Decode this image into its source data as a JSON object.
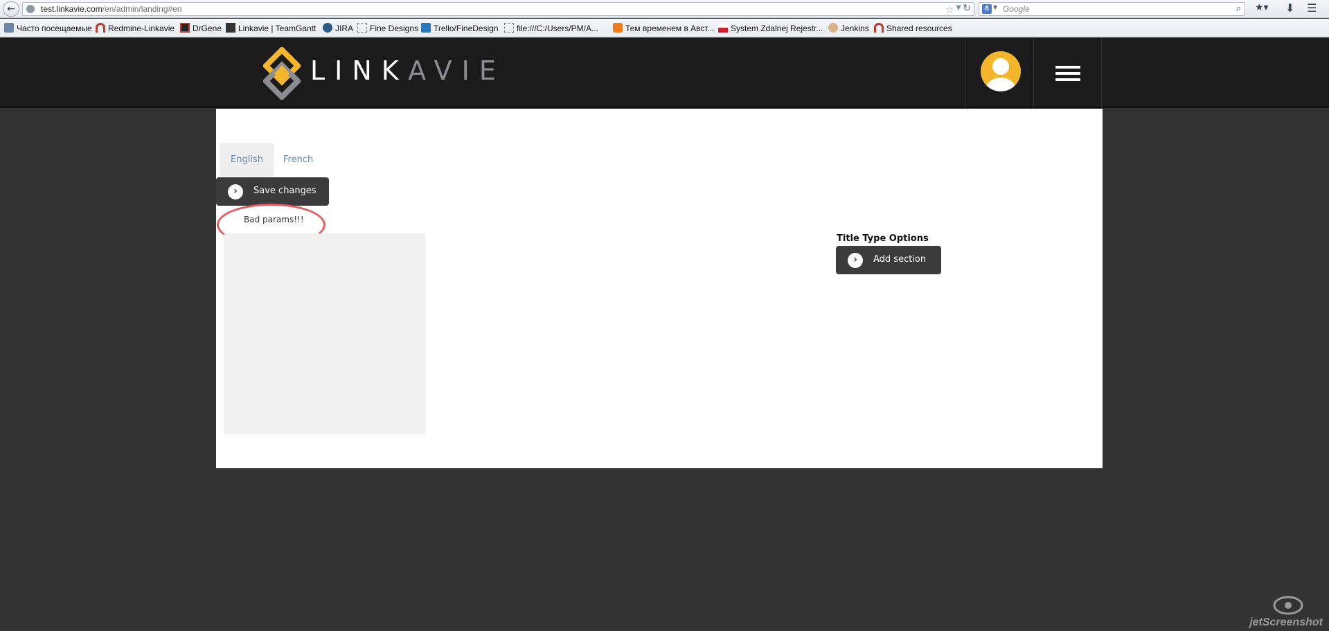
{
  "browser": {
    "url_host": "test.linkavie.com",
    "url_path": "/en/admin/landing#en",
    "search_placeholder": "Google",
    "search_engine_badge": "8"
  },
  "bookmarks": [
    {
      "label": "Часто посещаемые",
      "icon": "folder-icon"
    },
    {
      "label": "Redmine-Linkavie",
      "icon": "redmine-icon"
    },
    {
      "label": "DrGene",
      "icon": "drgene-icon"
    },
    {
      "label": "Linkavie | TeamGantt",
      "icon": "teamgantt-icon"
    },
    {
      "label": "JIRA",
      "icon": "jira-icon"
    },
    {
      "label": "Fine Designs",
      "icon": "page-icon"
    },
    {
      "label": "Trello/FineDesign",
      "icon": "trello-icon"
    },
    {
      "label": "file:///C:/Users/PM/A...",
      "icon": "page-icon"
    },
    {
      "label": "Тем временем в Авст...",
      "icon": "blogger-icon"
    },
    {
      "label": "System Zdalnej Rejestr...",
      "icon": "flag-icon"
    },
    {
      "label": "Jenkins",
      "icon": "jenkins-icon"
    },
    {
      "label": "Shared resources",
      "icon": "redmine-icon"
    }
  ],
  "site": {
    "logo_text_a": "LINK",
    "logo_text_b": "A",
    "logo_text_c": "VIE"
  },
  "tabs": [
    {
      "label": "English",
      "active": true
    },
    {
      "label": "French",
      "active": false
    }
  ],
  "save_button": {
    "label": "Save changes",
    "icon": "chevron-right-icon"
  },
  "error_message": "Bad params!!!",
  "options": {
    "title": "Title Type Options",
    "add_button": {
      "label": "Add section",
      "icon": "chevron-right-icon"
    }
  },
  "watermark": {
    "text": "jetScreenshot"
  },
  "colors": {
    "header_bg": "#1b1b1b",
    "page_bg": "#333333",
    "brand_yellow": "#f4b62a",
    "tab_link": "#5d89b5",
    "annotation_red": "#e45c63",
    "button_dark": "#3b3b3b"
  }
}
